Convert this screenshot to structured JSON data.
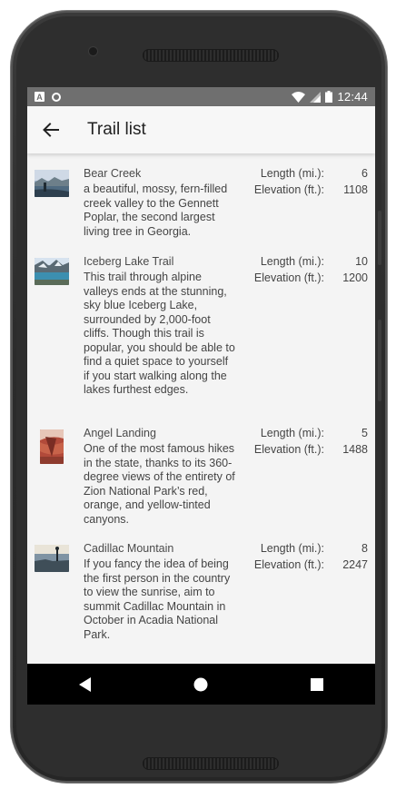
{
  "status_bar": {
    "time": "12:44",
    "left_icons": [
      "a-notification-icon",
      "circle-notification-icon"
    ],
    "right_icons": [
      "wifi-icon",
      "signal-icon",
      "battery-icon"
    ]
  },
  "app_bar": {
    "title": "Trail list",
    "back_icon": "arrow-back-icon"
  },
  "trails": [
    {
      "name": "Bear Creek",
      "description": "a beautiful, mossy, fern-filled creek valley to the Gennett Poplar, the second largest living tree in Georgia.",
      "length_label": "Length (mi.):",
      "length": "6",
      "elevation_label": "Elevation (ft.):",
      "elevation": "1108"
    },
    {
      "name": "Iceberg Lake Trail",
      "description": "This trail through alpine valleys ends at the stunning, sky blue Iceberg Lake, surrounded by 2,000-foot cliffs. Though this trail is popular, you should be able to find a quiet space to yourself if you start walking along the lakes furthest edges.",
      "length_label": "Length (mi.):",
      "length": "10",
      "elevation_label": "Elevation (ft.):",
      "elevation": "1200"
    },
    {
      "name": "Angel Landing",
      "description": "One of the most famous hikes in the state, thanks to its 360-degree views of the entirety of Zion National Park’s red, orange, and yellow-tinted canyons.",
      "length_label": "Length (mi.):",
      "length": "5",
      "elevation_label": "Elevation (ft.):",
      "elevation": "1488"
    },
    {
      "name": "Cadillac Mountain",
      "description": "If you fancy the idea of being the first person in the country to view the sunrise, aim to summit Cadillac Mountain in October in Acadia National Park.",
      "length_label": "Length (mi.):",
      "length": "8",
      "elevation_label": "Elevation (ft.):",
      "elevation": "2247"
    }
  ],
  "nav_bar": {
    "icons": [
      "back-triangle-icon",
      "home-circle-icon",
      "recents-square-icon"
    ]
  },
  "colors": {
    "status_bar": "#6f6f6f",
    "app_bar": "#f7f7f7",
    "screen_bg": "#f4f4f4",
    "nav_bar": "#000000",
    "device_frame": "#2e2e2e"
  }
}
